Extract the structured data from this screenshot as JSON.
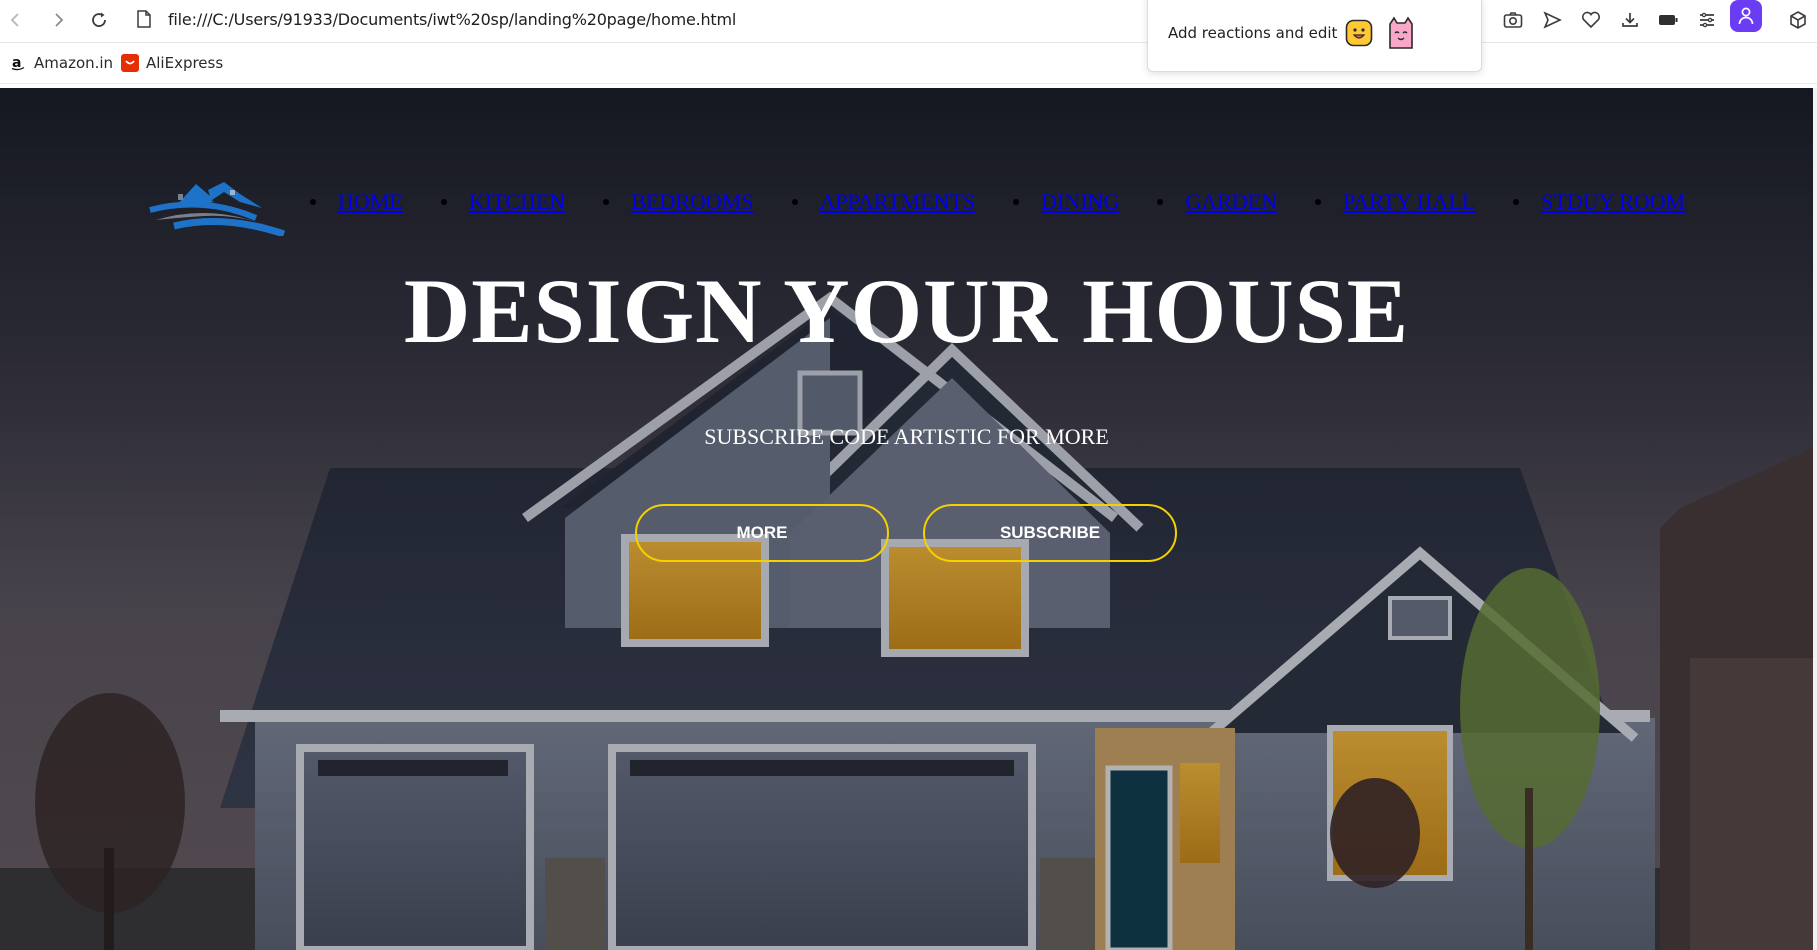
{
  "browser": {
    "url": "file:///C:/Users/91933/Documents/iwt%20sp/landing%20page/home.html",
    "reactions_popup_text": "Add reactions and edit",
    "bookmarks": [
      {
        "label": "Amazon.in",
        "icon": "amazon-icon"
      },
      {
        "label": "AliExpress",
        "icon": "aliexpress-icon"
      }
    ]
  },
  "nav": {
    "items": [
      {
        "label": "HOME"
      },
      {
        "label": "KITCHEN"
      },
      {
        "label": "BEDROOMS"
      },
      {
        "label": "APPARTMENTS"
      },
      {
        "label": "DINING"
      },
      {
        "label": "GARDEN"
      },
      {
        "label": "PARTY HALL"
      },
      {
        "label": "STDUY ROOM"
      }
    ]
  },
  "hero": {
    "title": "DESIGN YOUR HOUSE",
    "subtitle": "SUBSCRIBE CODE ARTISTIC FOR MORE",
    "buttons": {
      "more": "MORE",
      "subscribe": "SUBSCRIBE"
    }
  },
  "colors": {
    "button_border": "#f5d100",
    "link": "#0000ee",
    "logo_blue": "#1e73c8",
    "logo_gray": "#7a8089",
    "profile": "#6a3df5"
  }
}
